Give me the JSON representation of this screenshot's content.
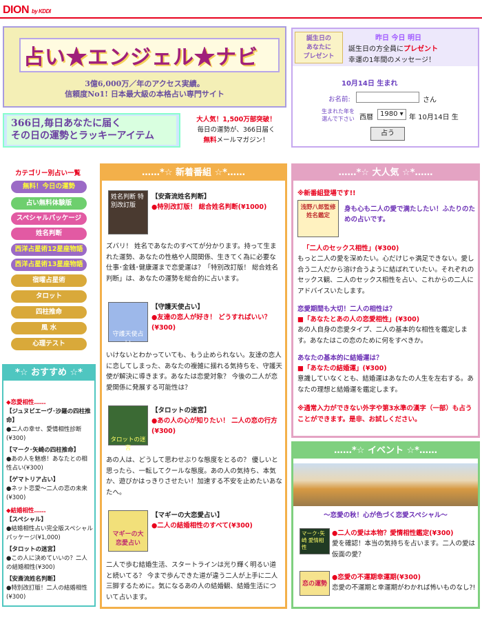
{
  "header": {
    "brand": "DION",
    "by": "by KDDI"
  },
  "banner": {
    "logo": "占い★エンジェル★ナビ",
    "tag1": "3億6,000万／年のアクセス実績。",
    "tag2": "信頼度No1! 日本最大級の本格占い専門サイト"
  },
  "promo": {
    "line1": "366日,毎日あなたに届く",
    "line2": "その日の運勢とラッキーアイテム",
    "t1": "大人気！1,500万部突破！",
    "t2": "毎日の運勢が、366日届く",
    "t3a": "無料",
    "t3b": "メールマガジン！"
  },
  "birthday": {
    "gift": "誕生日の\nあなたに\nプレゼント",
    "links": "昨日 今日 明日",
    "t1a": "誕生日の方全員に",
    "t1b": "プレゼント",
    "t2": "幸運の1年間のメッセージ！",
    "date": "10月14日 生まれ",
    "name_label": "お名前:",
    "san": "さん",
    "select_label": "生まれた年を\n選んで下さい",
    "era": "西暦",
    "year": "1980",
    "date2": "年 10月14日 生",
    "button": "占う"
  },
  "sections": {
    "new": "……*☆ 新着番組 ☆*……",
    "popular": "……*☆ 大人気 ☆*……",
    "recommend": "*☆ おすすめ ☆*",
    "event": "……*☆ イベント ☆*……"
  },
  "menu": {
    "title": "カテゴリー別占い一覧",
    "items": [
      "無料！今日の運勢",
      "占い無料体験版",
      "スペシャルパッケージ",
      "姓名判断",
      "西洋占星術12星座物語",
      "西洋占星術13星座物語",
      "宿曜占星術",
      "タロット",
      "四柱推命",
      "風 水",
      "心理テスト"
    ]
  },
  "recommend": {
    "h1": "◆恋愛相性……",
    "i1t": "【ジュヌビエーヴ･沙羅の四柱推命】",
    "i1d": "●二人の幸せ、愛情相性診断(¥300)",
    "i2t": "【マーク･矢崎の四柱推命】",
    "i2d": "●あの人を魅惑！あなたとの相性占い(¥300)",
    "i3t": "【ゲマトリア占い】",
    "i3d": "●ネット恋愛〜二人の恋の未来(¥300)",
    "h2": "◆結婚相性……",
    "i4t": "【スペシャル】",
    "i4d": "●結婚相性占い完全版スペシャルパッケージ(¥1,000)",
    "i5t": "【タロットの迷宮】",
    "i5d": "●この人に決めていいの？二人の結婚相性(¥300)",
    "i6t": "【安斎流姓名判断】",
    "i6d": "●特別改訂版！二人の結婚相性(¥300)"
  },
  "new_items": [
    {
      "title": "【安斎流姓名判断】",
      "sub": "●特別改訂版！ 総合姓名判断(¥1000)",
      "thumb": "姓名判断 特別改訂版",
      "body": "ズバリ！ 姓名であなたのすべてが分かります。持って生まれた運勢、あなたの性格や人間関係、生きてく為に必要な仕事･金銭･健康運まで恋愛運は？「特別改訂版！ 総合姓名判断」は、あなたの運勢を総合的に占います。"
    },
    {
      "title": "【守護天使占い】",
      "sub": "●友達の恋人が好き！ どうすればいい？(¥300)",
      "thumb": "守護天使占い",
      "body": "いけないとわかっていても、もう止められない。友達の恋人に恋してしまった、あなたの複雑に揺れる気持ちを、守護天使が解決に導きます。あなたは恋愛対象？ 今後の二人が恋愛関係に発展する可能性は？"
    },
    {
      "title": "【タロットの迷宮】",
      "sub": "●あの人の心が知りたい！ 二人の恋の行方(¥300)",
      "thumb": "タロットの迷宮",
      "body": "あの人は、どうして思わせぶりな態度をとるの？ 優しいと思ったら、一転してクールな態度。あの人の気持ち、本気か、遊びかはっきりさせたい！加速する不安を止めたいあなたへ。"
    },
    {
      "title": "【マギーの大恋愛占い】",
      "sub": "●二人の結婚相性のすべて(¥300)",
      "thumb": "マギーの大恋愛占い",
      "body": "二人で歩む結婚生活、スタートラインは光り輝く明るい道と続いてる？ 今まで歩んできた道が違う二人が上手に二人三脚するために。気になるあの人の結婚観、結婚生活について占います。"
    }
  ],
  "popular": {
    "tag": "※新番組登場です!!",
    "thumb": "浅野八郎監修 姓名鑑定",
    "head": "身も心も二人の愛で満たしたい！ふたりのための占いです。",
    "p1t": "「二人のセックス相性」(¥300)",
    "p1": "もっと二人の愛を深めたい。心だけじゃ満足できない。愛し合う二人だから溶け合うように結ばれていたい。それぞれのセックス観、二人のセックス相性を占い、これからの二人にアドバイスいたします。",
    "p2h": "恋愛期間も大切！二人の相性は？",
    "p2t": "■「あなたとあの人の恋愛相性」(¥300)",
    "p2": "あの人自身の恋愛タイプ、二人の基本的な相性を鑑定します。あなたはこの恋のために何をすべきか。",
    "p3h": "あなたの基本的に結婚運は？",
    "p3t": "■「あなたの結婚運」(¥300)",
    "p3": "意識していなくとも、結婚運はあなたの人生を左右する。あなたの理想と結婚運を鑑定します。",
    "note": "※通常入力ができない外字や第3水準の漢字（一部）も占うことができます。是非、お試しください。"
  },
  "event": {
    "subtitle": "〜恋愛の秋！心が色づく恋愛スペシャル〜",
    "e1t": "●二人の愛は本物？愛情相性鑑定(¥300)",
    "e1": "愛を確認！本当の気持ちを占います。二人の愛は仮面の愛？",
    "e1thumb": "マーク･矢崎 愛情相性",
    "e2t": "●恋愛の不運期幸運期(¥300)",
    "e2": "恋愛の不運期と幸運期がわかれば怖いものなし?!",
    "e2thumb": "恋の運勢"
  },
  "colors": {
    "accent": "#e8001c",
    "purple": "#6b2fb5",
    "menu_border": "#f3b04a",
    "new_border": "#f3b04a",
    "popular_border": "#e4a3c3",
    "event_border": "#7fd07f",
    "recommend_border": "#4fc6c0"
  }
}
